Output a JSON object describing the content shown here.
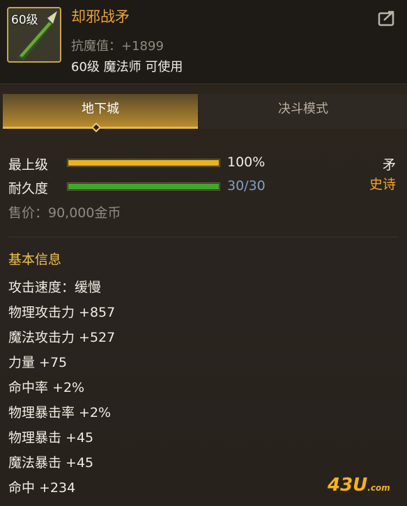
{
  "item": {
    "level_badge": "60级",
    "name": "却邪战矛",
    "resist": "抗魔值：+1899",
    "requirement": "60级 魔法师 可使用"
  },
  "tabs": [
    {
      "label": "地下城",
      "active": true
    },
    {
      "label": "决斗模式",
      "active": false
    }
  ],
  "bars": {
    "max_level": {
      "label": "最上级",
      "value_text": "100%",
      "fraction": 1.0,
      "color": "#e8b321"
    },
    "durability": {
      "label": "耐久度",
      "value_text": "30/30",
      "fraction": 1.0,
      "color": "#3fa82b"
    }
  },
  "item_type": "矛",
  "rarity": "史诗",
  "price": "售价：90,000金币",
  "basic_info": {
    "title": "基本信息",
    "stats": [
      "攻击速度：缓慢",
      "物理攻击力 +857",
      "魔法攻击力 +527",
      "力量 +75",
      "命中率 +2%",
      "物理暴击率 +2%",
      "物理暴击 +45",
      "魔法暴击 +45",
      "命中 +234"
    ]
  },
  "watermark": {
    "main": "43U",
    "suffix": ".com"
  },
  "colors": {
    "accent": "#e7a23a",
    "rarity": "#f0a52a",
    "section": "#f0c44a"
  }
}
